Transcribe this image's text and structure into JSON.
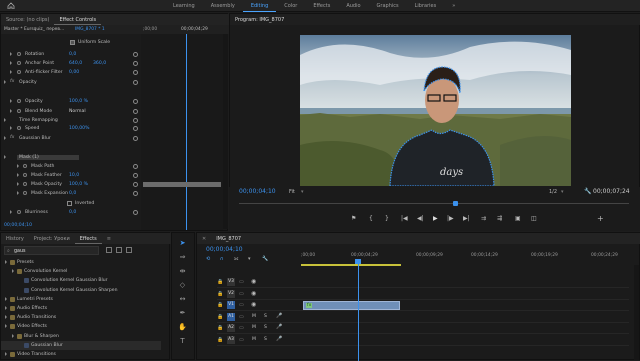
{
  "topbar": {
    "workspaces": [
      "Learning",
      "Assembly",
      "Editing",
      "Color",
      "Effects",
      "Audio",
      "Graphics",
      "Libraries"
    ],
    "active": "Editing",
    "more": "»"
  },
  "source_panel": {
    "tabs": [
      "Source: (no clips)",
      "Effect Controls"
    ],
    "active_tab": "Effect Controls",
    "master_label": "Master * Eursquiz_ перев...",
    "clip_label": "IMG_8707 * 1",
    "ruler_start": ";00;00",
    "ruler_mid": "00;00;04;29",
    "rows": [
      {
        "label": "Uniform Scale",
        "value": ""
      },
      {
        "label": "Rotation",
        "value": "0,0"
      },
      {
        "label": "Anchor Point",
        "value": "640,0",
        "value2": "360,0"
      },
      {
        "label": "Anti-flicker Filter",
        "value": "0,00"
      },
      {
        "label": "Opacity",
        "value": ""
      },
      {
        "label": "Opacity",
        "value": "100,0 %"
      },
      {
        "label": "Blend Mode",
        "value": "Normal"
      },
      {
        "label": "Time Remapping",
        "value": ""
      },
      {
        "label": "Speed",
        "value": "100,00%"
      },
      {
        "label": "Gaussian Blur",
        "value": ""
      },
      {
        "label": "Mask (1)",
        "value": ""
      },
      {
        "label": "Mask Path",
        "value": ""
      },
      {
        "label": "Mask Feather",
        "value": "10,0"
      },
      {
        "label": "Mask Opacity",
        "value": "100,0 %"
      },
      {
        "label": "Mask Expansion",
        "value": "0,0"
      },
      {
        "label": "Inverted",
        "value": ""
      },
      {
        "label": "Blurriness",
        "value": "0,0"
      }
    ],
    "timecode": "00;00;04;10"
  },
  "program": {
    "title": "Program: IMG_8707",
    "timecode_left": "00;00;04;10",
    "fit": "Fit",
    "ratio": "1/2",
    "timecode_right": "00;00;07;24",
    "video_caption": "days"
  },
  "project_panel": {
    "tabs": [
      "History",
      "Project: Уроки",
      "Effects"
    ],
    "active_tab": "Effects",
    "search_value": "gaus",
    "items": [
      {
        "label": "Presets",
        "level": 0,
        "type": "folder"
      },
      {
        "label": "Convolution Kernel",
        "level": 1,
        "type": "folder"
      },
      {
        "label": "Convolution Kernel Gaussian Blur",
        "level": 2,
        "type": "fx"
      },
      {
        "label": "Convolution Kernel Gaussian Sharpen",
        "level": 2,
        "type": "fx"
      },
      {
        "label": "Lumetri Presets",
        "level": 0,
        "type": "folder"
      },
      {
        "label": "Audio Effects",
        "level": 0,
        "type": "folder"
      },
      {
        "label": "Audio Transitions",
        "level": 0,
        "type": "folder"
      },
      {
        "label": "Video Effects",
        "level": 0,
        "type": "folder"
      },
      {
        "label": "Blur & Sharpen",
        "level": 1,
        "type": "folder"
      },
      {
        "label": "Gaussian Blur",
        "level": 2,
        "type": "fx"
      },
      {
        "label": "Video Transitions",
        "level": 0,
        "type": "folder"
      }
    ]
  },
  "timeline": {
    "tab": "IMG_8707",
    "timecode": "00;00;04;10",
    "ruler": [
      ";00;00",
      "00;00;04;29",
      "00;00;09;29",
      "00;00;14;29",
      "00;00;19;29",
      "00;00;24;29"
    ],
    "video_tracks": [
      "V3",
      "V2",
      "V1"
    ],
    "audio_tracks": [
      "A1",
      "A2",
      "A3"
    ],
    "track_buttons": {
      "mute": "M",
      "solo": "S"
    },
    "clip_label": "fx"
  },
  "colors": {
    "accent": "#3c92ee",
    "active_tab": "#4aa4ff"
  }
}
